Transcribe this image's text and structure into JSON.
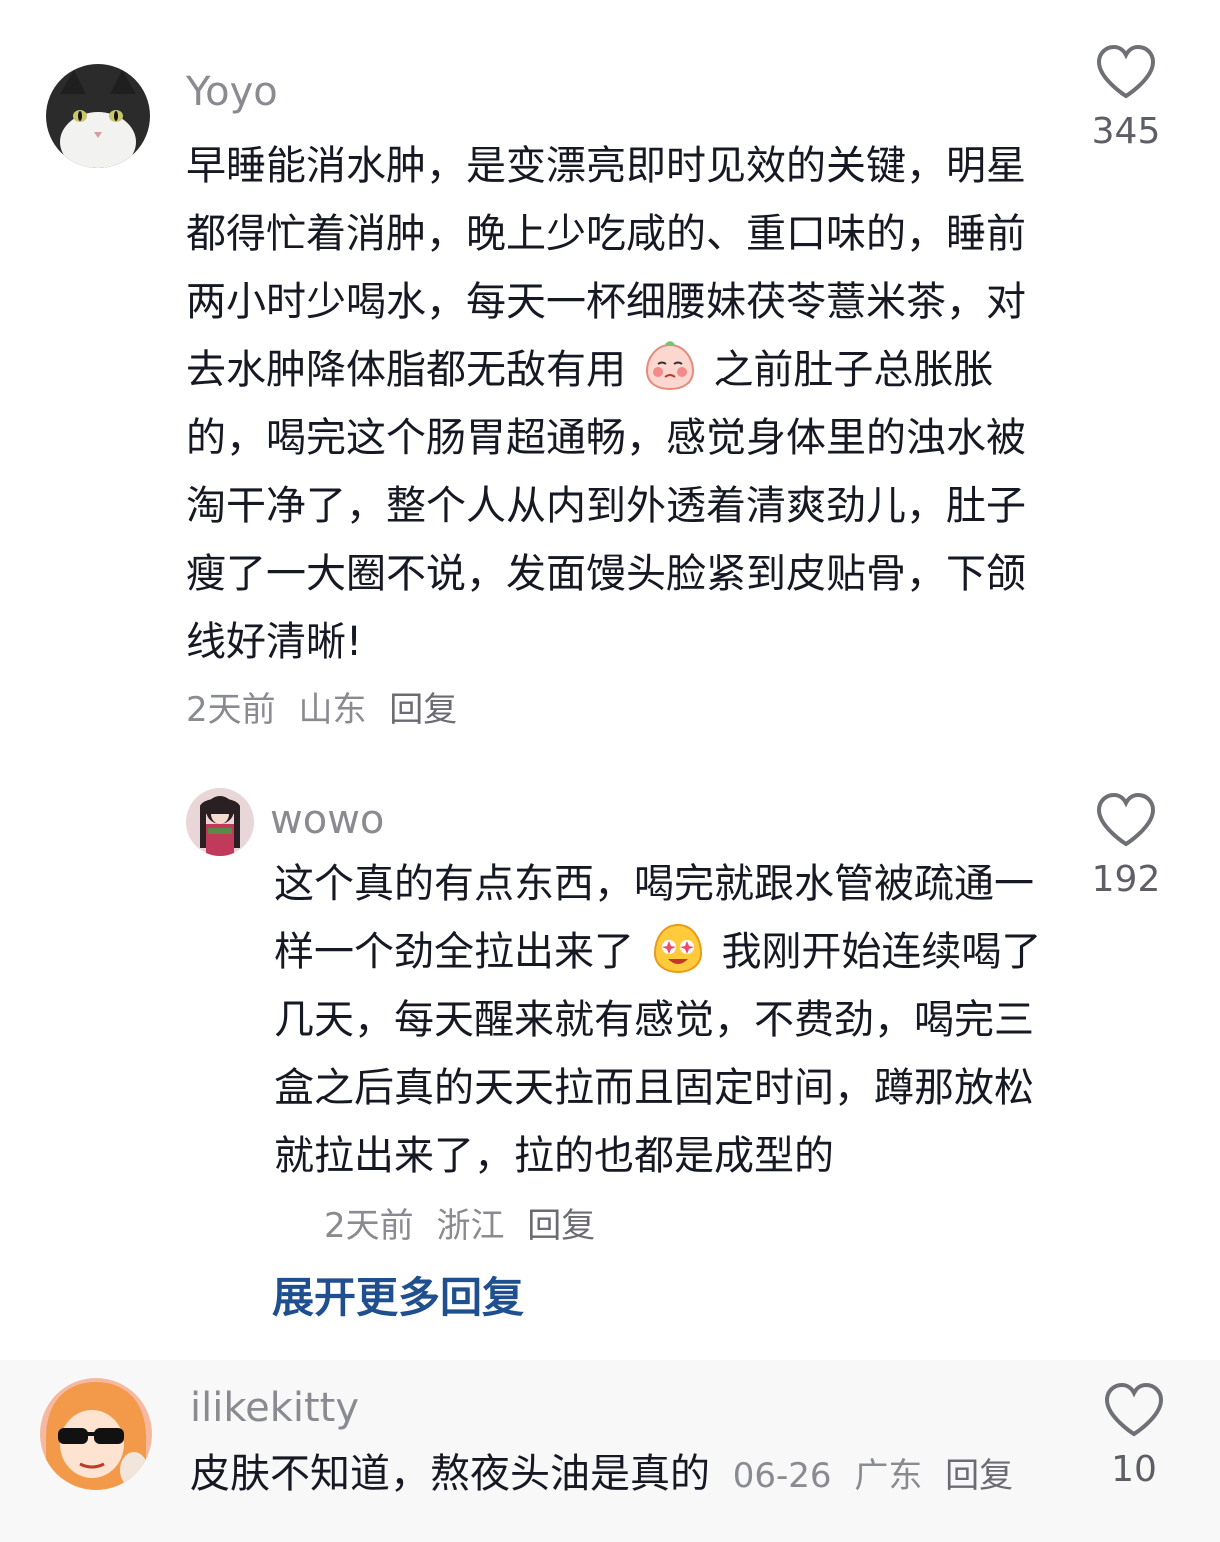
{
  "comments": [
    {
      "username": "Yoyo",
      "text_before_emoji": "早睡能消水肿，是变漂亮即时见效的关键，明星都得忙着消肿，晚上少吃咸的、重口味的，睡前两小时少喝水，每天一杯细腰妹茯苓薏米茶，对去水肿降体脂都无敌有用",
      "emoji": "blushing-peach-emoji",
      "text_after_emoji": "之前肚子总胀胀的，喝完这个肠胃超通畅，感觉身体里的浊水被淘干净了，整个人从内到外透着清爽劲儿，肚子瘦了一大圈不说，发面馒头脸紧到皮贴骨，下颌线好清晰!",
      "time": "2天前",
      "location": "山东",
      "reply_label": "回复",
      "likes": "345",
      "avatar_icon": "cat-avatar"
    },
    {
      "username": "wowo",
      "text_before_emoji": "这个真的有点东西，喝完就跟水管被疏通一样一个劲全拉出来了",
      "emoji": "starry-eyed-emoji",
      "text_after_emoji": "我刚开始连续喝了几天，每天醒来就有感觉，不费劲，喝完三盒之后真的天天拉而且固定时间，蹲那放松就拉出来了，拉的也都是成型的",
      "time": "2天前",
      "location": "浙江",
      "reply_label": "回复",
      "likes": "192",
      "avatar_icon": "anime-girl-avatar"
    },
    {
      "username": "ilikekitty",
      "text": "皮肤不知道，熬夜头油是真的",
      "time": "06-26",
      "location": "广东",
      "reply_label": "回复",
      "likes": "10",
      "avatar_icon": "sunglasses-girl-avatar"
    }
  ],
  "expand_replies_label": "展开更多回复",
  "colors": {
    "text": "#161823",
    "meta": "#8a8b91",
    "expand_link": "#1f4f8f",
    "third_bg": "#f8f8f8"
  }
}
